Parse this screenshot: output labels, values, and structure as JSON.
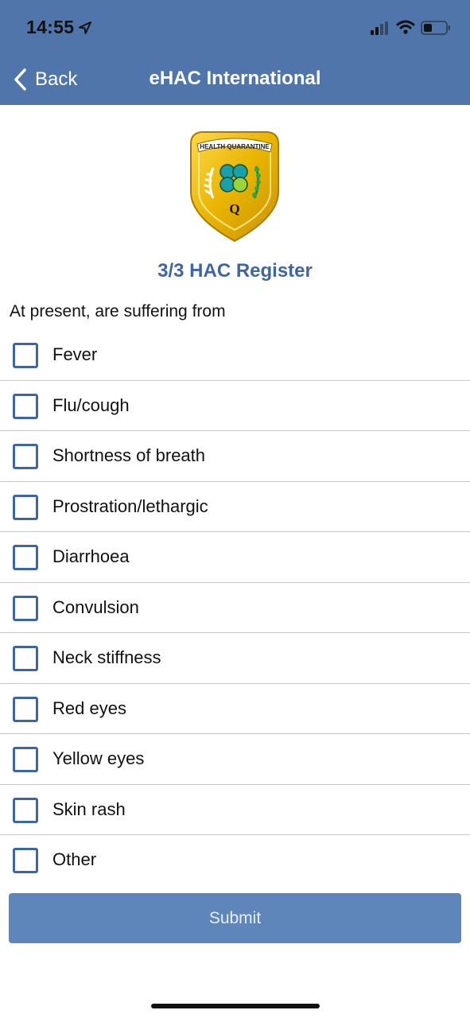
{
  "status_bar": {
    "time": "14:55",
    "icons": [
      "location-arrow-icon",
      "cellular-signal-icon",
      "wifi-icon",
      "battery-icon"
    ]
  },
  "nav": {
    "back_label": "Back",
    "title": "eHAC International"
  },
  "emblem": {
    "text_banner": "HEALTH QUARANTINE",
    "letter": "Q"
  },
  "main": {
    "heading": "3/3 HAC Register",
    "question": "At present, are suffering from",
    "symptoms": [
      {
        "label": "Fever",
        "checked": false
      },
      {
        "label": "Flu/cough",
        "checked": false
      },
      {
        "label": "Shortness of breath",
        "checked": false
      },
      {
        "label": "Prostration/lethargic",
        "checked": false
      },
      {
        "label": "Diarrhoea",
        "checked": false
      },
      {
        "label": "Convulsion",
        "checked": false
      },
      {
        "label": "Neck stiffness",
        "checked": false
      },
      {
        "label": "Red eyes",
        "checked": false
      },
      {
        "label": "Yellow eyes",
        "checked": false
      },
      {
        "label": "Skin rash",
        "checked": false
      },
      {
        "label": "Other",
        "checked": false
      }
    ],
    "submit_label": "Submit"
  },
  "colors": {
    "header_bg": "#4f75aa",
    "accent": "#3e66a1",
    "submit_bg": "#5e86ba",
    "emblem_gold": "#e8b400"
  }
}
